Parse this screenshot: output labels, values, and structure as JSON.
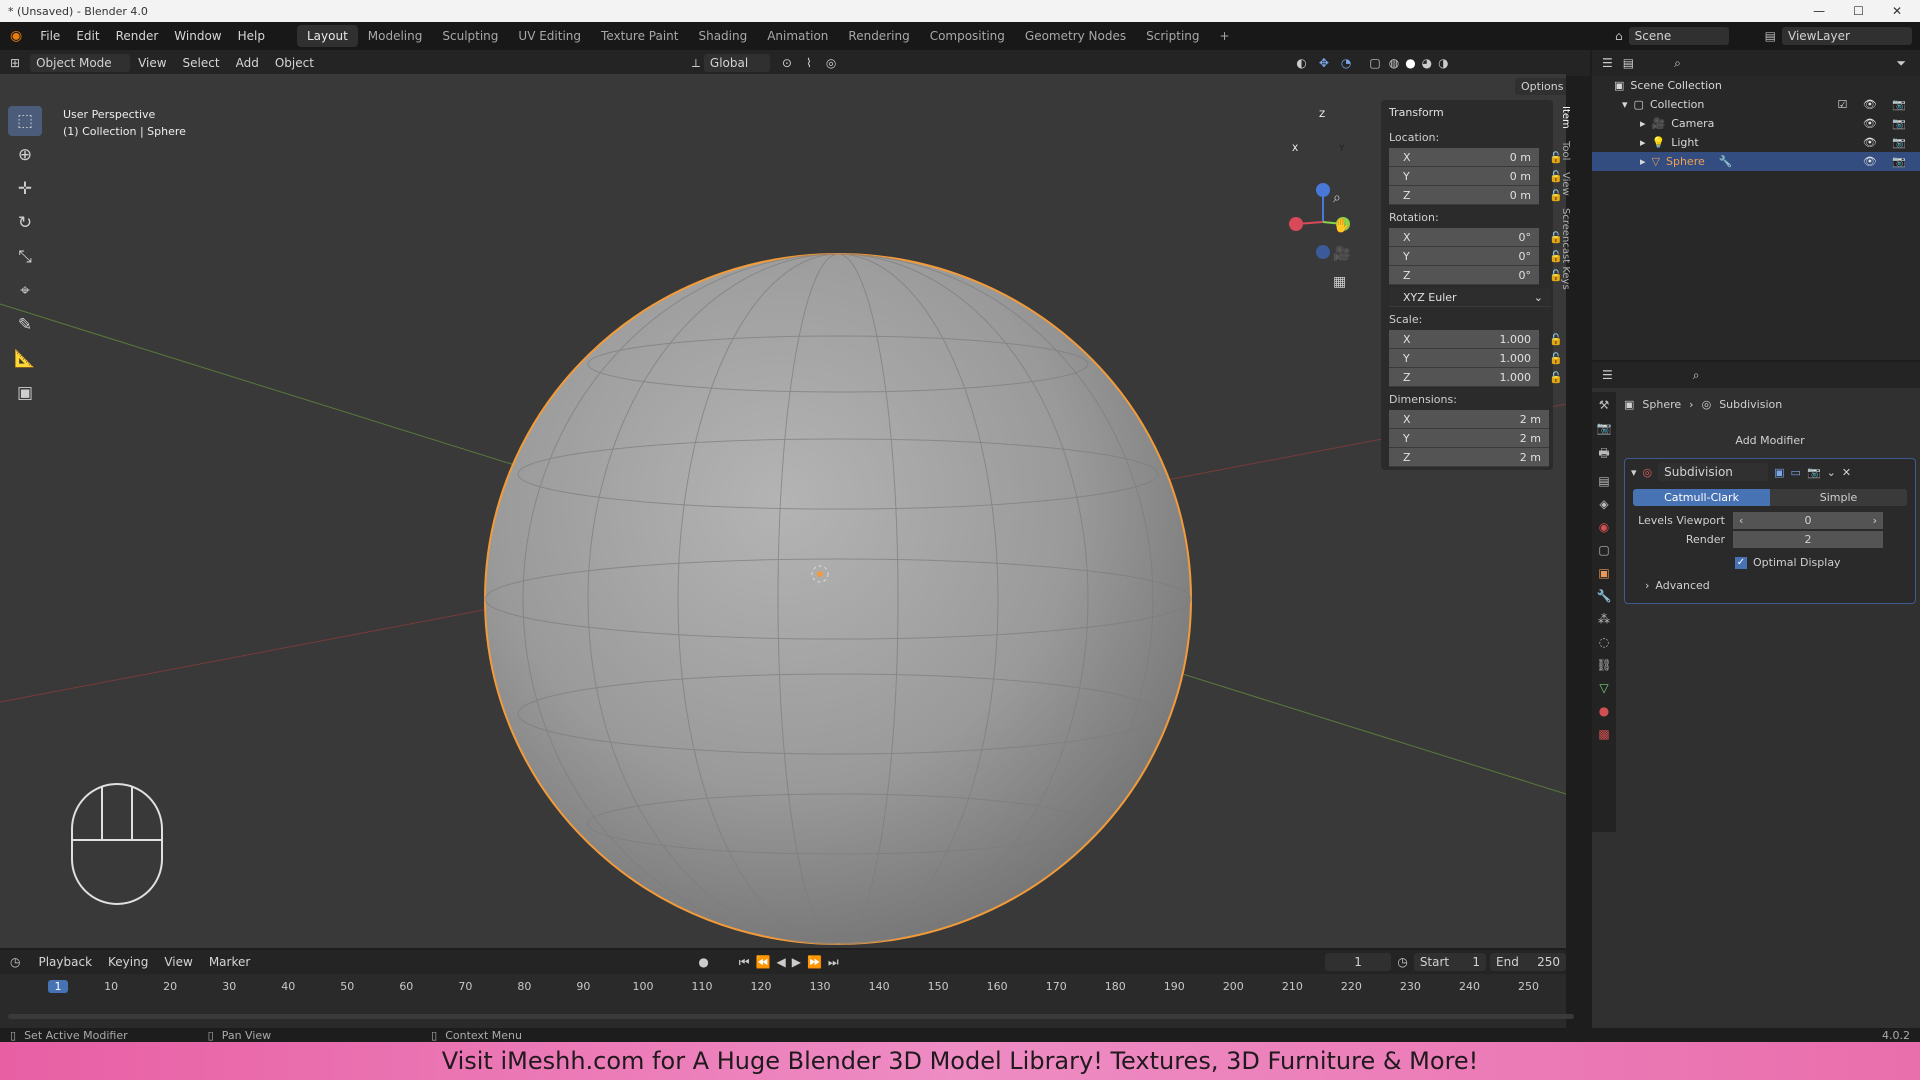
{
  "window": {
    "title": "* (Unsaved) - Blender 4.0"
  },
  "menu": [
    "File",
    "Edit",
    "Render",
    "Window",
    "Help"
  ],
  "workspaces": [
    "Layout",
    "Modeling",
    "Sculpting",
    "UV Editing",
    "Texture Paint",
    "Shading",
    "Animation",
    "Rendering",
    "Compositing",
    "Geometry Nodes",
    "Scripting"
  ],
  "workspace_active": "Layout",
  "scene": {
    "name": "Scene",
    "view_layer": "ViewLayer"
  },
  "viewport_header": {
    "mode": "Object Mode",
    "menus": [
      "View",
      "Select",
      "Add",
      "Object"
    ],
    "orientation": "Global",
    "options": "Options"
  },
  "viewport_overlay": {
    "line1": "User Perspective",
    "line2": "(1) Collection | Sphere"
  },
  "gizmo": {
    "x": "X",
    "y": "Y",
    "z": "Z"
  },
  "npanel": {
    "title": "Transform",
    "location_label": "Location:",
    "rotation_label": "Rotation:",
    "scale_label": "Scale:",
    "dimensions_label": "Dimensions:",
    "location": [
      {
        "axis": "X",
        "value": "0 m"
      },
      {
        "axis": "Y",
        "value": "0 m"
      },
      {
        "axis": "Z",
        "value": "0 m"
      }
    ],
    "rotation": [
      {
        "axis": "X",
        "value": "0°"
      },
      {
        "axis": "Y",
        "value": "0°"
      },
      {
        "axis": "Z",
        "value": "0°"
      }
    ],
    "rotation_mode": "XYZ Euler",
    "scale": [
      {
        "axis": "X",
        "value": "1.000"
      },
      {
        "axis": "Y",
        "value": "1.000"
      },
      {
        "axis": "Z",
        "value": "1.000"
      }
    ],
    "dimensions": [
      {
        "axis": "X",
        "value": "2 m"
      },
      {
        "axis": "Y",
        "value": "2 m"
      },
      {
        "axis": "Z",
        "value": "2 m"
      }
    ],
    "tabs": [
      "Item",
      "Tool",
      "View",
      "Screencast Keys"
    ]
  },
  "outliner": {
    "root": "Scene Collection",
    "collection": "Collection",
    "items": [
      "Camera",
      "Light",
      "Sphere"
    ]
  },
  "properties": {
    "breadcrumb_object": "Sphere",
    "breadcrumb_modifier": "Subdivision",
    "add_modifier": "Add Modifier",
    "modifier_name": "Subdivision",
    "type_a": "Catmull-Clark",
    "type_b": "Simple",
    "levels_viewport_label": "Levels Viewport",
    "levels_viewport": "0",
    "render_label": "Render",
    "render": "2",
    "optimal_display": "Optimal Display",
    "advanced": "Advanced"
  },
  "timeline": {
    "menus": [
      "Playback",
      "Keying",
      "View",
      "Marker"
    ],
    "current_frame": "1",
    "start_label": "Start",
    "start": "1",
    "end_label": "End",
    "end": "250",
    "ticks": [
      "1",
      "10",
      "20",
      "30",
      "40",
      "50",
      "60",
      "70",
      "80",
      "90",
      "100",
      "110",
      "120",
      "130",
      "140",
      "150",
      "160",
      "170",
      "180",
      "190",
      "200",
      "210",
      "220",
      "230",
      "240",
      "250"
    ]
  },
  "statusbar": {
    "a": "Set Active Modifier",
    "b": "Pan View",
    "c": "Context Menu",
    "version": "4.0.2"
  },
  "banner": "Visit iMeshh.com for A Huge Blender 3D Model Library! Textures, 3D Furniture & More!"
}
